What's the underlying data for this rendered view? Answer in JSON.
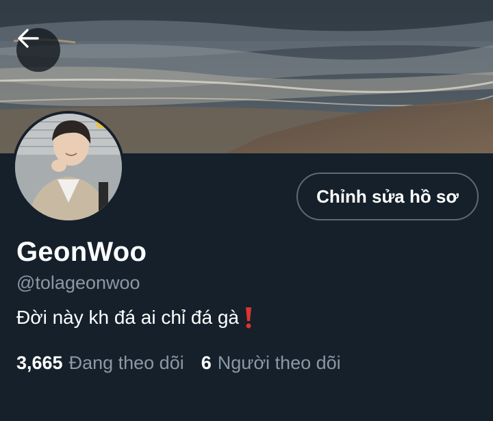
{
  "header": {
    "back_icon": "arrow-left-icon"
  },
  "profile": {
    "display_name": "GeonWoo",
    "handle": "@tolageonwoo",
    "bio": "Đời này kh đá ai chỉ đá gà",
    "bio_emoji": "red-exclamation-mark-emoji",
    "edit_button_label": "Chỉnh sửa hồ sơ",
    "following_count": "3,665",
    "following_label": "Đang theo dõi",
    "followers_count": "6",
    "followers_label": "Người theo dõi"
  },
  "colors": {
    "background": "#15202b",
    "text_primary": "#ffffff",
    "text_secondary": "#8b98a5",
    "button_border": "#5e6a74",
    "emoji_red": "#e0342c"
  }
}
